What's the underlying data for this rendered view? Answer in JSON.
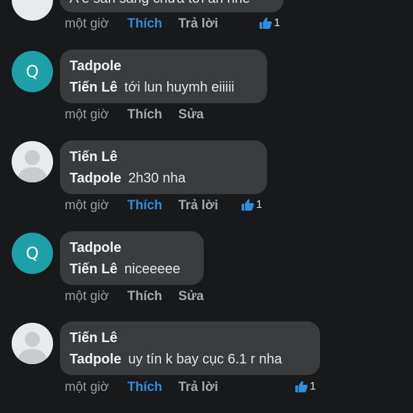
{
  "top_partial": {
    "text": "A ê sẵn sàng chưa tới ăn nhé",
    "time": "một giờ",
    "like_label": "Thích",
    "reply_label": "Trả lời",
    "reaction_count": "1"
  },
  "comments": [
    {
      "avatar": "Q",
      "author": "Tadpole",
      "mention": "Tiến Lê",
      "text": "tới lun huymh eiiiii",
      "time": "một giờ",
      "like_label": "Thích",
      "second_action": "Sửa"
    },
    {
      "avatar": "",
      "author": "Tiến Lê",
      "mention": "Tadpole",
      "text": "2h30 nha",
      "time": "một giờ",
      "like_label": "Thích",
      "second_action": "Trả lời",
      "reaction_count": "1"
    },
    {
      "avatar": "Q",
      "author": "Tadpole",
      "mention": "Tiến Lê",
      "text": "niceeeee",
      "time": "một giờ",
      "like_label": "Thích",
      "second_action": "Sửa"
    },
    {
      "avatar": "",
      "author": "Tiến Lê",
      "mention": "Tadpole",
      "text": "uy tín k bay cục 6.1 r nha",
      "time": "một giờ",
      "like_label": "Thích",
      "second_action": "Trả lời",
      "reaction_count": "1"
    }
  ],
  "colors": {
    "background": "#18191a",
    "bubble": "#3a3b3c",
    "like_active": "#2d8ee0",
    "avatar_q": "#1ea0a8"
  }
}
